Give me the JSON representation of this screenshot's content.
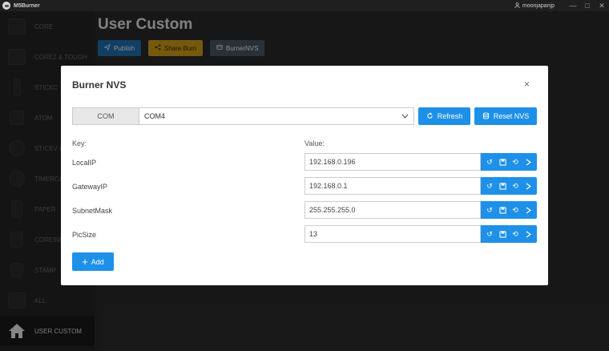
{
  "window": {
    "app_name": "M5Burner",
    "user": "moonjapanjp",
    "minimize": "—",
    "restore": "□",
    "close": "✕"
  },
  "sidebar": {
    "items": [
      {
        "label": "CORE"
      },
      {
        "label": "CORE2 & TOUGH"
      },
      {
        "label": "STICKC"
      },
      {
        "label": "ATOM"
      },
      {
        "label": "STICKV & UNITV"
      },
      {
        "label": "TIMERCAM"
      },
      {
        "label": "PAPER"
      },
      {
        "label": "COREINK"
      },
      {
        "label": "STAMP"
      },
      {
        "label": "ALL"
      },
      {
        "label": "USER CUSTOM"
      }
    ]
  },
  "main": {
    "title": "User Custom",
    "publish_label": "Publish",
    "share_label": "Share Burn",
    "nvs_label": "BurnerNVS"
  },
  "modal": {
    "title": "Burner NVS",
    "close": "×",
    "com_label": "COM",
    "com_value": "COM4",
    "refresh_label": "Refresh",
    "reset_label": "Reset NVS",
    "key_header": "Key:",
    "value_header": "Value:",
    "rows": [
      {
        "key": "LocalIP",
        "value": "192.168.0.196"
      },
      {
        "key": "GatewayIP",
        "value": "192.168.0.1"
      },
      {
        "key": "SubnetMask",
        "value": "255.255.255.0"
      },
      {
        "key": "PicSize",
        "value": "13"
      }
    ],
    "add_label": "Add"
  },
  "colors": {
    "accent": "#1e90e8",
    "publish": "#1f73b7",
    "share": "#d9a21b",
    "nvs": "#4a5a66"
  }
}
